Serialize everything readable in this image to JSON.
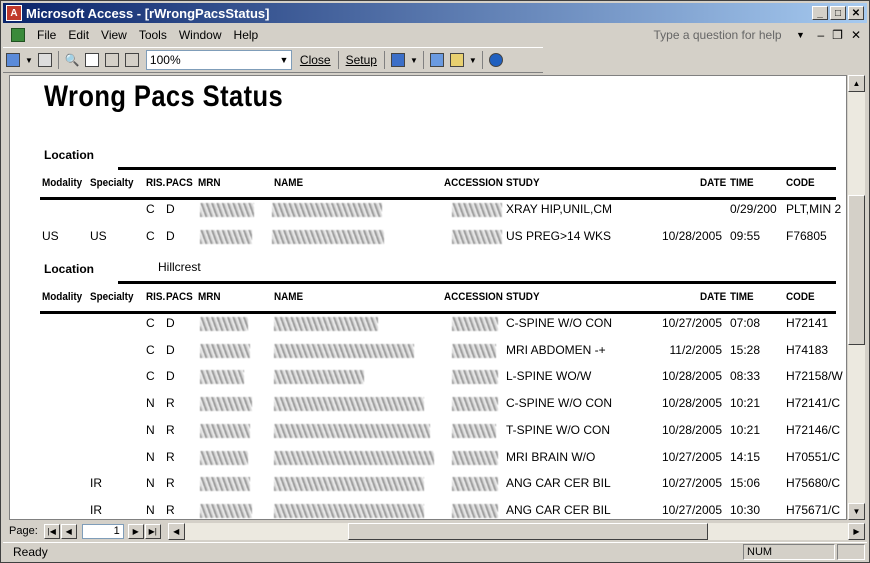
{
  "window": {
    "title": "Microsoft Access - [rWrongPacsStatus]"
  },
  "menu": {
    "items": [
      "File",
      "Edit",
      "View",
      "Tools",
      "Window",
      "Help"
    ],
    "help_placeholder": "Type a question for help"
  },
  "toolbar": {
    "zoom": "100%",
    "close_label": "Close",
    "setup_label": "Setup"
  },
  "report": {
    "title": "Wrong Pacs Status",
    "headers": [
      "Modality",
      "Specialty",
      "RIS.",
      "PACS",
      "MRN",
      "NAME",
      "ACCESSION",
      "STUDY",
      "DATE",
      "TIME",
      "CODE"
    ],
    "groups": [
      {
        "location_label": "Location",
        "location": "",
        "rows": [
          {
            "modality": "",
            "specialty": "",
            "ris": "C",
            "pacs": "D",
            "study": "XRAY HIP,UNIL,CM",
            "date": "",
            "time": "0/29/200",
            "code": "PLT,MIN 2"
          },
          {
            "modality": "US",
            "specialty": "US",
            "ris": "C",
            "pacs": "D",
            "study": "US PREG>14 WKS",
            "date": "10/28/2005",
            "time": "09:55",
            "code": "F76805"
          }
        ]
      },
      {
        "location_label": "Location",
        "location": "Hillcrest",
        "rows": [
          {
            "modality": "",
            "specialty": "",
            "ris": "C",
            "pacs": "D",
            "study": "C-SPINE W/O CON",
            "date": "10/27/2005",
            "time": "07:08",
            "code": "H72141"
          },
          {
            "modality": "",
            "specialty": "",
            "ris": "C",
            "pacs": "D",
            "study": "MRI ABDOMEN -+",
            "date": "11/2/2005",
            "time": "15:28",
            "code": "H74183"
          },
          {
            "modality": "",
            "specialty": "",
            "ris": "C",
            "pacs": "D",
            "study": "L-SPINE WO/W",
            "date": "10/28/2005",
            "time": "08:33",
            "code": "H72158/W"
          },
          {
            "modality": "",
            "specialty": "",
            "ris": "N",
            "pacs": "R",
            "study": "C-SPINE W/O CON",
            "date": "10/28/2005",
            "time": "10:21",
            "code": "H72141/C"
          },
          {
            "modality": "",
            "specialty": "",
            "ris": "N",
            "pacs": "R",
            "study": "T-SPINE W/O CON",
            "date": "10/28/2005",
            "time": "10:21",
            "code": "H72146/C"
          },
          {
            "modality": "",
            "specialty": "",
            "ris": "N",
            "pacs": "R",
            "study": "MRI BRAIN W/O",
            "date": "10/27/2005",
            "time": "14:15",
            "code": "H70551/C"
          },
          {
            "modality": "",
            "specialty": "IR",
            "ris": "N",
            "pacs": "R",
            "study": "ANG CAR CER BIL",
            "date": "10/27/2005",
            "time": "15:06",
            "code": "H75680/C"
          },
          {
            "modality": "",
            "specialty": "IR",
            "ris": "N",
            "pacs": "R",
            "study": "ANG CAR CER BIL",
            "date": "10/27/2005",
            "time": "10:30",
            "code": "H75671/C"
          }
        ]
      }
    ]
  },
  "pager": {
    "label": "Page:",
    "page": "1"
  },
  "status": {
    "text": "Ready",
    "num": "NUM"
  }
}
